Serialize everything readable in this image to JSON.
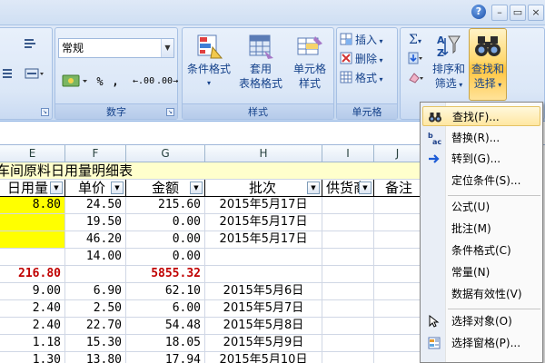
{
  "ribbon": {
    "number_format_value": "常规",
    "number_group_label": "数字",
    "style_group_label": "样式",
    "cells_group_label": "单元格",
    "edit_group_label": "编辑",
    "percent_label": "%",
    "comma_label": ",",
    "inc_decimal_label": ".00",
    "dec_decimal_label": ".00",
    "conditional_format_label": "条件格式",
    "format_table_label1": "套用",
    "format_table_label2": "表格格式",
    "cell_style_label1": "单元格",
    "cell_style_label2": "样式",
    "insert_label": "插入",
    "delete_label": "删除",
    "format_label": "格式",
    "sort_filter_label1": "排序和",
    "sort_filter_label2": "筛选",
    "find_select_label1": "查找和",
    "find_select_label2": "选择",
    "help_glyph": "?"
  },
  "columns": [
    "E",
    "F",
    "G",
    "H",
    "I",
    "J"
  ],
  "sheet": {
    "title": "车间原料日用量明细表",
    "headers": {
      "e": "日用量",
      "f": "单价",
      "g": "金额",
      "h": "批次",
      "i": "供货商",
      "j": "备注"
    },
    "rows": [
      {
        "e": "8.80",
        "f": "24.50",
        "g": "215.60",
        "h": "2015年5月17日",
        "e_yellow": true
      },
      {
        "e": "",
        "f": "19.50",
        "g": "0.00",
        "h": "2015年5月17日",
        "e_yellow": true
      },
      {
        "e": "",
        "f": "46.20",
        "g": "0.00",
        "h": "2015年5月17日",
        "e_yellow": true
      },
      {
        "e": "",
        "f": "14.00",
        "g": "0.00",
        "h": ""
      },
      {
        "e": "216.80",
        "f": "",
        "g": "5855.32",
        "h": "",
        "bold_red": true
      },
      {
        "e": "9.00",
        "f": "6.90",
        "g": "62.10",
        "h": "2015年5月6日"
      },
      {
        "e": "2.40",
        "f": "2.50",
        "g": "6.00",
        "h": "2015年5月7日"
      },
      {
        "e": "2.40",
        "f": "22.70",
        "g": "54.48",
        "h": "2015年5月8日"
      },
      {
        "e": "1.18",
        "f": "15.30",
        "g": "18.05",
        "h": "2015年5月9日"
      },
      {
        "e": "1.30",
        "f": "13.80",
        "g": "17.94",
        "h": "2015年5月10日"
      }
    ]
  },
  "menu": {
    "items": [
      {
        "label": "查找(F)...",
        "icon": "binoculars-icon"
      },
      {
        "label": "替换(R)...",
        "icon": "replace-icon"
      },
      {
        "label": "转到(G)...",
        "icon": "goto-arrow-icon"
      },
      {
        "label": "定位条件(S)...",
        "icon": ""
      },
      {
        "label": "公式(U)",
        "icon": ""
      },
      {
        "label": "批注(M)",
        "icon": ""
      },
      {
        "label": "条件格式(C)",
        "icon": ""
      },
      {
        "label": "常量(N)",
        "icon": ""
      },
      {
        "label": "数据有效性(V)",
        "icon": ""
      },
      {
        "label": "选择对象(O)",
        "icon": "select-objects-icon"
      },
      {
        "label": "选择窗格(P)...",
        "icon": "selection-pane-icon"
      }
    ]
  }
}
